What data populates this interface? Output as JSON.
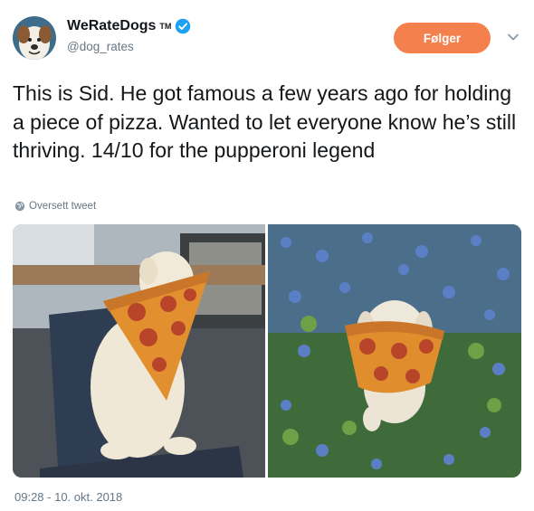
{
  "author": {
    "display_name": "WeRateDogs",
    "trademark": "TM",
    "handle": "@dog_rates",
    "avatar_icon": "dog-avatar-icon",
    "verified_icon": "verified-badge-icon"
  },
  "actions": {
    "follow_label": "Følger",
    "menu_icon": "chevron-down-icon"
  },
  "tweet": {
    "text": "This is Sid. He got famous a few years ago for holding a piece of pizza. Wanted to let everyone know he’s still thriving. 14/10 for the pupperoni legend",
    "translate_label": "Oversett tweet",
    "timestamp": "09:28 - 10. okt. 2018"
  },
  "media": {
    "photos": [
      "dog-with-pizza-on-chair",
      "dog-with-pizza-in-bluebonnets"
    ]
  },
  "colors": {
    "follow_bg": "#f4804d",
    "verified": "#1da1f2",
    "secondary_text": "#657786"
  }
}
